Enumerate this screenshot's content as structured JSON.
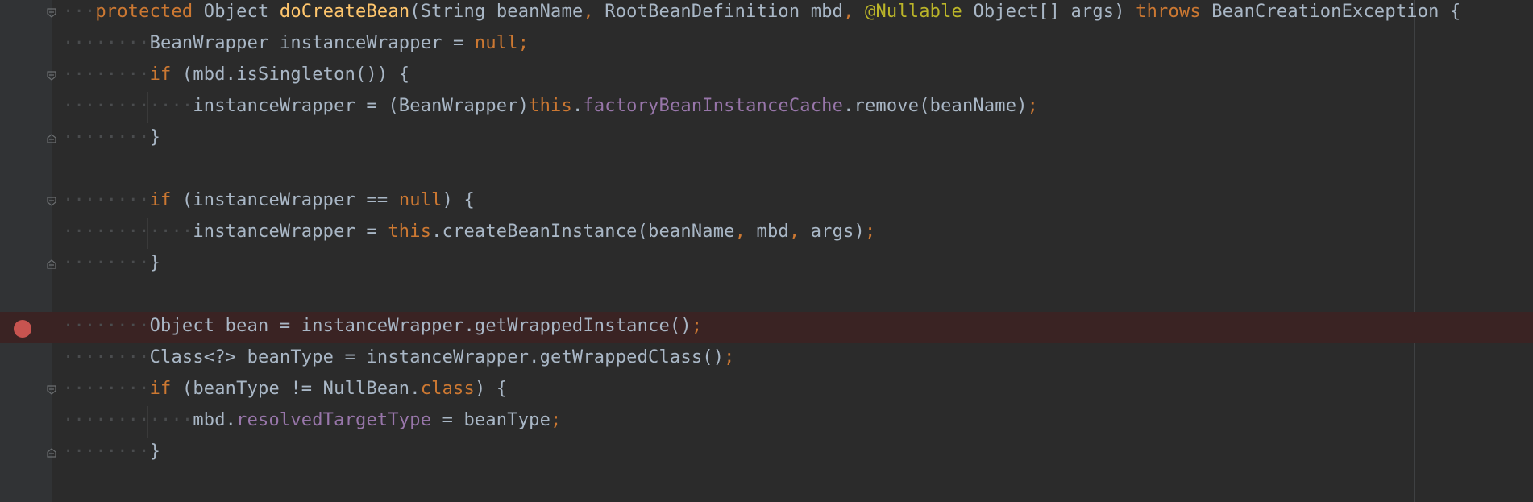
{
  "editor": {
    "theme_colors": {
      "background": "#2b2b2b",
      "keyword": "#cc7832",
      "method": "#ffc66d",
      "field": "#9876aa",
      "annotation": "#bbb529",
      "text": "#a9b7c6",
      "breakpoint": "#c75450"
    },
    "lines": [
      {
        "indent": 3,
        "fold": "open",
        "breakpoint": false,
        "highlight": false,
        "tokens": [
          [
            "kw",
            "protected"
          ],
          [
            "t",
            " Object "
          ],
          [
            "fn",
            "doCreateBean"
          ],
          [
            "t",
            "(String beanName"
          ],
          [
            "kw",
            ","
          ],
          [
            "t",
            " RootBeanDefinition mbd"
          ],
          [
            "kw",
            ","
          ],
          [
            "t",
            " "
          ],
          [
            "ann",
            "@Nullable"
          ],
          [
            "t",
            " Object[] args) "
          ],
          [
            "kw",
            "throws"
          ],
          [
            "t",
            " BeanCreationException {"
          ]
        ]
      },
      {
        "indent": 8,
        "fold": null,
        "breakpoint": false,
        "highlight": false,
        "tokens": [
          [
            "t",
            "BeanWrapper instanceWrapper = "
          ],
          [
            "kw",
            "null;"
          ]
        ]
      },
      {
        "indent": 8,
        "fold": "open",
        "breakpoint": false,
        "highlight": false,
        "tokens": [
          [
            "kw",
            "if"
          ],
          [
            "t",
            " (mbd.isSingleton()) {"
          ]
        ]
      },
      {
        "indent": 12,
        "fold": null,
        "breakpoint": false,
        "highlight": false,
        "guide": true,
        "tokens": [
          [
            "t",
            "instanceWrapper = (BeanWrapper)"
          ],
          [
            "kw",
            "this"
          ],
          [
            "t",
            "."
          ],
          [
            "field",
            "factoryBeanInstanceCache"
          ],
          [
            "t",
            ".remove(beanName)"
          ],
          [
            "kw",
            ";"
          ]
        ]
      },
      {
        "indent": 8,
        "fold": "close",
        "breakpoint": false,
        "highlight": false,
        "tokens": [
          [
            "t",
            "}"
          ]
        ]
      },
      {
        "indent": 0,
        "fold": null,
        "breakpoint": false,
        "highlight": false,
        "tokens": []
      },
      {
        "indent": 8,
        "fold": "open",
        "breakpoint": false,
        "highlight": false,
        "tokens": [
          [
            "kw",
            "if"
          ],
          [
            "t",
            " (instanceWrapper == "
          ],
          [
            "kw",
            "null"
          ],
          [
            "t",
            ") {"
          ]
        ]
      },
      {
        "indent": 12,
        "fold": null,
        "breakpoint": false,
        "highlight": false,
        "guide": true,
        "tokens": [
          [
            "t",
            "instanceWrapper = "
          ],
          [
            "kw",
            "this"
          ],
          [
            "t",
            ".createBeanInstance(beanName"
          ],
          [
            "kw",
            ","
          ],
          [
            "t",
            " mbd"
          ],
          [
            "kw",
            ","
          ],
          [
            "t",
            " args)"
          ],
          [
            "kw",
            ";"
          ]
        ]
      },
      {
        "indent": 8,
        "fold": "close",
        "breakpoint": false,
        "highlight": false,
        "tokens": [
          [
            "t",
            "}"
          ]
        ]
      },
      {
        "indent": 0,
        "fold": null,
        "breakpoint": false,
        "highlight": false,
        "tokens": []
      },
      {
        "indent": 8,
        "fold": null,
        "breakpoint": true,
        "highlight": true,
        "tokens": [
          [
            "t",
            "Object bean = instanceWrapper.getWrappedInstance()"
          ],
          [
            "kw",
            ";"
          ]
        ]
      },
      {
        "indent": 8,
        "fold": null,
        "breakpoint": false,
        "highlight": false,
        "tokens": [
          [
            "t",
            "Class<?> beanType = instanceWrapper.getWrappedClass()"
          ],
          [
            "kw",
            ";"
          ]
        ]
      },
      {
        "indent": 8,
        "fold": "open",
        "breakpoint": false,
        "highlight": false,
        "tokens": [
          [
            "kw",
            "if"
          ],
          [
            "t",
            " (beanType != NullBean."
          ],
          [
            "kw",
            "class"
          ],
          [
            "t",
            ") {"
          ]
        ]
      },
      {
        "indent": 12,
        "fold": null,
        "breakpoint": false,
        "highlight": false,
        "guide": true,
        "tokens": [
          [
            "t",
            "mbd."
          ],
          [
            "field",
            "resolvedTargetType"
          ],
          [
            "t",
            " = beanType"
          ],
          [
            "kw",
            ";"
          ]
        ]
      },
      {
        "indent": 8,
        "fold": "close",
        "breakpoint": false,
        "highlight": false,
        "tokens": [
          [
            "t",
            "}"
          ]
        ]
      }
    ]
  }
}
